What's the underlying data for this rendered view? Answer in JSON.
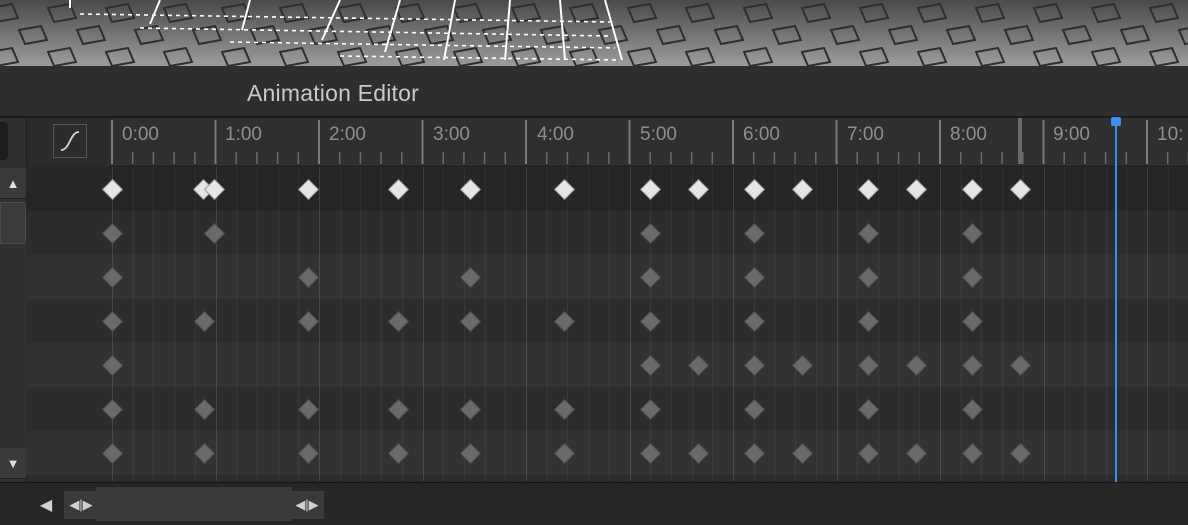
{
  "editor": {
    "title": "Animation Editor"
  },
  "ruler": {
    "labels": [
      "0:00",
      "1:00",
      "2:00",
      "3:00",
      "4:00",
      "5:00",
      "6:00",
      "7:00",
      "8:00",
      "9:00",
      "10:"
    ]
  },
  "controls": {
    "scroll_up": "▲",
    "scroll_down": "▼",
    "step_back": "◀",
    "handle_left": "◀|▶",
    "handle_right": "◀|▶"
  },
  "colors": {
    "playhead": "#3b8df0",
    "keyframe_selected": "#e6e6e6",
    "keyframe": "#6a6a6a"
  }
}
